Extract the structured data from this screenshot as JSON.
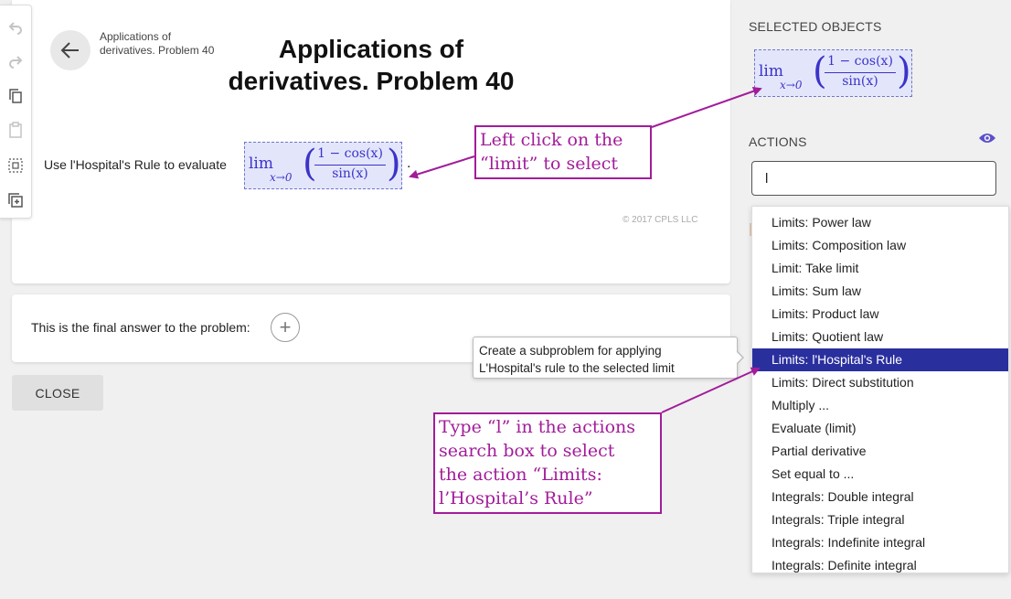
{
  "problem": {
    "breadcrumb": "Applications of derivatives. Problem 40",
    "title": "Applications of derivatives. Problem 40",
    "prompt": "Use l'Hospital's Rule to evaluate",
    "math": {
      "operator": "lim",
      "subscript": "x→0",
      "numerator": "1 − cos(x)",
      "denominator": "sin(x)"
    },
    "trailing": ".",
    "copyright": "© 2017 CPLS LLC"
  },
  "answer": {
    "text": "This is the final answer to the problem:",
    "add_symbol": "+"
  },
  "close_label": "CLOSE",
  "right_panel": {
    "selected_header": "SELECTED OBJECTS",
    "actions_header": "ACTIONS",
    "search_value": "l",
    "dropdown_items": [
      "Limits: Power law",
      "Limits: Composition law",
      "Limit: Take limit",
      "Limits: Sum law",
      "Limits: Product law",
      "Limits: Quotient law",
      "Limits: l'Hospital's Rule",
      "Limits: Direct substitution",
      "Multiply ...",
      "Evaluate (limit)",
      "Partial derivative",
      "Set equal to ...",
      "Integrals: Double integral",
      "Integrals: Triple integral",
      "Integrals: Indefinite integral",
      "Integrals: Definite integral"
    ],
    "selected_index": 6
  },
  "tooltip": {
    "line1": "Create a subproblem for applying",
    "line2": "L'Hospital's rule to the selected limit"
  },
  "callouts": {
    "select_line1": "Left click on the",
    "select_line2": "“limit” to select",
    "type_line1": "Type “l” in the actions",
    "type_line2": "search box to select",
    "type_line3": "the action “Limits:",
    "type_line4": "l’Hospital’s Rule”"
  },
  "toolbar": {
    "icons": [
      "undo-icon",
      "redo-icon",
      "copy-icon",
      "paste-icon",
      "select-all-icon",
      "add-box-icon"
    ]
  },
  "colors": {
    "accent": "#2a2f9e",
    "math": "#3b33c9",
    "math_bg": "#e3e6fb",
    "callout": "#a21c9a",
    "eye": "#5b50c8"
  }
}
